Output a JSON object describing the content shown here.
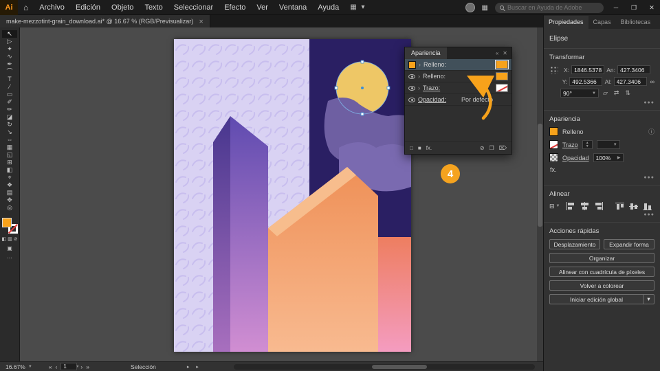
{
  "chrome": {
    "logo": "Ai",
    "home_icon": "⌂",
    "menus": [
      "Archivo",
      "Edición",
      "Objeto",
      "Texto",
      "Seleccionar",
      "Efecto",
      "Ver",
      "Ventana",
      "Ayuda"
    ],
    "workspace_icon": "▦ ▾",
    "search_placeholder": "Buscar en Ayuda de Adobe",
    "minimize": "─",
    "restore": "❐",
    "close": "✕"
  },
  "tab": {
    "title": "make-mezzotint-grain_download.ai* @ 16.67 % (RGB/Previsualizar)",
    "close": "✕"
  },
  "tools": [
    {
      "name": "selection",
      "glyph": "↖"
    },
    {
      "name": "direct-selection",
      "glyph": "▷"
    },
    {
      "name": "magic-wand",
      "glyph": "✦"
    },
    {
      "name": "lasso",
      "glyph": "∿"
    },
    {
      "name": "pen",
      "glyph": "✒"
    },
    {
      "name": "curvature",
      "glyph": "⌒"
    },
    {
      "name": "type",
      "glyph": "T"
    },
    {
      "name": "line-segment",
      "glyph": "∕"
    },
    {
      "name": "rectangle",
      "glyph": "▭"
    },
    {
      "name": "paintbrush",
      "glyph": "✐"
    },
    {
      "name": "pencil",
      "glyph": "✏"
    },
    {
      "name": "eraser",
      "glyph": "◪"
    },
    {
      "name": "rotate",
      "glyph": "↻"
    },
    {
      "name": "scale",
      "glyph": "↘"
    },
    {
      "name": "width",
      "glyph": "⇔"
    },
    {
      "name": "free-transform",
      "glyph": "▦"
    },
    {
      "name": "shape-builder",
      "glyph": "◱"
    },
    {
      "name": "mesh",
      "glyph": "⊞"
    },
    {
      "name": "gradient",
      "glyph": "◧"
    },
    {
      "name": "eyedropper",
      "glyph": "⌖"
    },
    {
      "name": "blend",
      "glyph": "❖"
    },
    {
      "name": "artboard",
      "glyph": "▤"
    },
    {
      "name": "hand",
      "glyph": "✥"
    },
    {
      "name": "zoom",
      "glyph": "◎"
    }
  ],
  "tool_minis": {
    "color": "◧",
    "gradient": "▥",
    "none": "⊘",
    "draw_mode": "▣",
    "more": "⋯"
  },
  "appearance_float": {
    "title": "Apariencia",
    "collapse_icon": "«",
    "close_icon": "✕",
    "expander": "›",
    "rows": [
      {
        "label": "Relleno:"
      },
      {
        "label": "Relleno:"
      },
      {
        "label": "Trazo:"
      },
      {
        "label": "Opacidad:",
        "value": "Por defecto"
      }
    ],
    "footer": {
      "stroke": "□",
      "fill": "■",
      "fx": "fx.",
      "clear": "⊘",
      "duplicate": "❐",
      "delete": "⌦"
    }
  },
  "badge": "4",
  "props": {
    "tabs": [
      "Propiedades",
      "Capas",
      "Bibliotecas"
    ],
    "object_type": "Elipse",
    "transform": {
      "title": "Transformar",
      "x_label": "X:",
      "x": "1846.5378",
      "y_label": "Y:",
      "y": "492.5366",
      "w_label": "An:",
      "w": "427.3406",
      "h_label": "Al:",
      "h": "427.3406",
      "angle": "90°",
      "link_icon": "∞",
      "shear_icon": "▱",
      "flip_h_icon": "⇄",
      "flip_v_icon": "⇅",
      "more": "●●●"
    },
    "appearance": {
      "title": "Apariencia",
      "fill_label": "Relleno",
      "stroke_label": "Trazo",
      "opacity_label": "Opacidad",
      "opacity_value": "100%",
      "info_icon": "ⓘ",
      "fx_label": "fx.",
      "more": "●●●"
    },
    "align": {
      "title": "Alinear",
      "dd_icon": "⊟",
      "more": "●●●"
    },
    "quick": {
      "title": "Acciones rápidas",
      "buttons": [
        "Desplazamiento",
        "Expandir forma",
        "Organizar",
        "Alinear con cuadrícula de píxeles",
        "Volver a colorear",
        "Iniciar edición global"
      ],
      "caret": "▾"
    }
  },
  "statusbar": {
    "zoom": "16.67%",
    "first": "«",
    "prev": "‹",
    "page": "1",
    "next": "›",
    "last": "»",
    "tool_label": "Selección",
    "menu_arrows": "▸ ▸",
    "caret": "▾"
  },
  "colors": {
    "accent_orange": "#F7A21B",
    "sky_navy": "#2A1F63",
    "wall_lavender": "#D9D2F3",
    "moon_yellow": "#EEC766",
    "building_orange": "#F09A66",
    "cloud_mauve": "#6E5FA2"
  }
}
